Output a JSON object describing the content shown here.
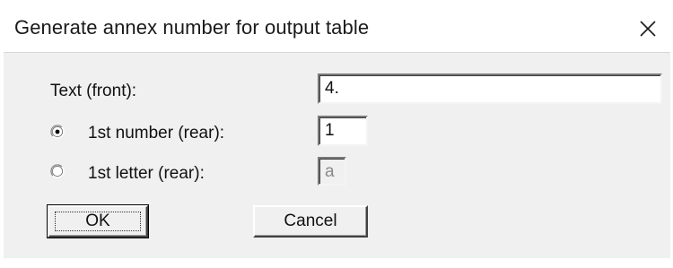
{
  "dialog": {
    "title": "Generate annex number for output table",
    "close_icon": "close-icon"
  },
  "form": {
    "text_front_label": "Text (front):",
    "text_front_value": "4.",
    "number_rear_label": "1st number (rear):",
    "number_rear_value": "1",
    "number_rear_selected": true,
    "letter_rear_label": "1st letter (rear):",
    "letter_rear_value": "a",
    "letter_rear_selected": false
  },
  "buttons": {
    "ok_label": "OK",
    "cancel_label": "Cancel"
  }
}
